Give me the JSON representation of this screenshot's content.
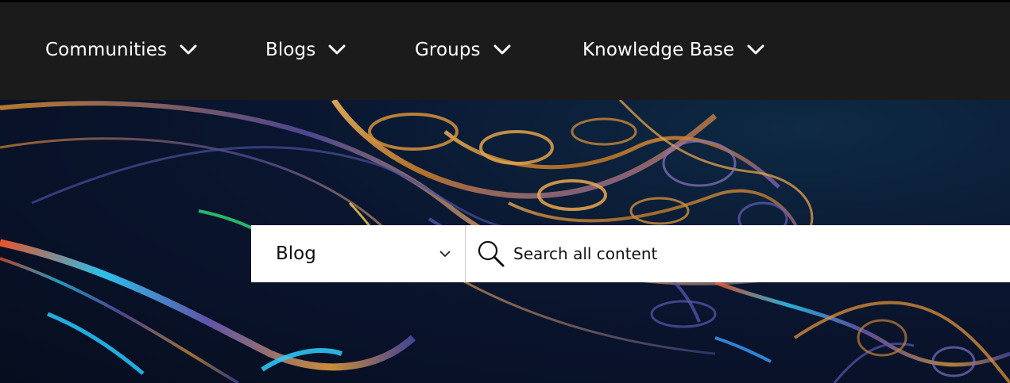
{
  "nav": {
    "items": [
      {
        "label": "Communities"
      },
      {
        "label": "Blogs"
      },
      {
        "label": "Groups"
      },
      {
        "label": "Knowledge Base"
      }
    ]
  },
  "search": {
    "scope_selected": "Blog",
    "placeholder": "Search all content"
  },
  "icons": {
    "nav_dropdown": "chevron-down-icon",
    "scope_dropdown": "chevron-down-icon",
    "search": "search-icon"
  },
  "colors": {
    "nav_background": "#1b1b1b",
    "nav_text": "#ffffff",
    "hero_background": "#0a1630",
    "search_background": "#ffffff"
  }
}
